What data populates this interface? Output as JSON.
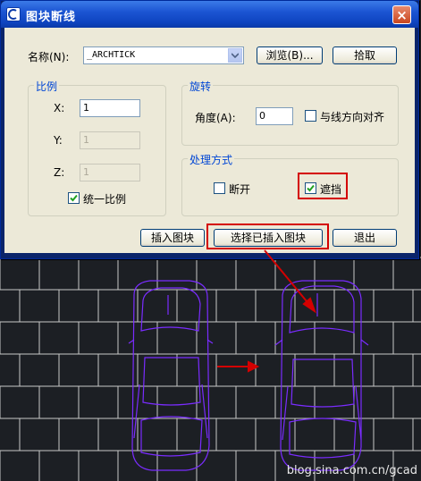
{
  "dialog": {
    "title": "图块断线",
    "close_glyph": "×",
    "name_label": "名称(N):",
    "name_value": "_ARCHTICK",
    "browse_label": "浏览(B)...",
    "pick_label": "拾取",
    "scale": {
      "group_title": "比例",
      "x_label": "X:",
      "x_value": "1",
      "y_label": "Y:",
      "y_value": "1",
      "z_label": "Z:",
      "z_value": "1",
      "uniform_label": "统一比例",
      "uniform_checked": true
    },
    "rotation": {
      "group_title": "旋转",
      "angle_label": "角度(A):",
      "angle_value": "0",
      "align_label": "与线方向对齐",
      "align_checked": false
    },
    "processing": {
      "group_title": "处理方式",
      "break_label": "断开",
      "break_checked": false,
      "mask_label": "遮挡",
      "mask_checked": true
    },
    "insert_block_label": "插入图块",
    "select_inserted_label": "选择已插入图块",
    "exit_label": "退出"
  },
  "watermark": "blog.sina.com.cn/gcad",
  "colors": {
    "cad_background": "#1c1f24",
    "grid_lines": "#c8c8c8",
    "car_outline": "#7a2cff",
    "highlight_red": "#d40000",
    "group_title": "#0046d5",
    "titlebar": "#1c55d3"
  }
}
